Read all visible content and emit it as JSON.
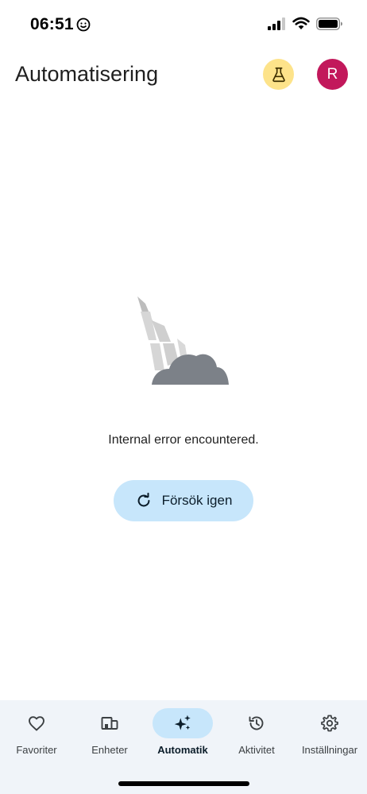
{
  "status_bar": {
    "time": "06:51"
  },
  "header": {
    "title": "Automatisering",
    "avatar_initial": "R"
  },
  "error": {
    "message": "Internal error encountered.",
    "retry_label": "Försök igen"
  },
  "bottom_nav": {
    "items": [
      {
        "label": "Favoriter",
        "icon": "heart-icon"
      },
      {
        "label": "Enheter",
        "icon": "devices-icon"
      },
      {
        "label": "Automatik",
        "icon": "sparkle-icon",
        "active": true
      },
      {
        "label": "Aktivitet",
        "icon": "history-icon"
      },
      {
        "label": "Inställningar",
        "icon": "gear-icon"
      }
    ]
  },
  "colors": {
    "accent": "#c7e6fb",
    "labs": "#fde38a",
    "avatar": "#c2185b",
    "nav_bg": "#f0f4f9"
  }
}
